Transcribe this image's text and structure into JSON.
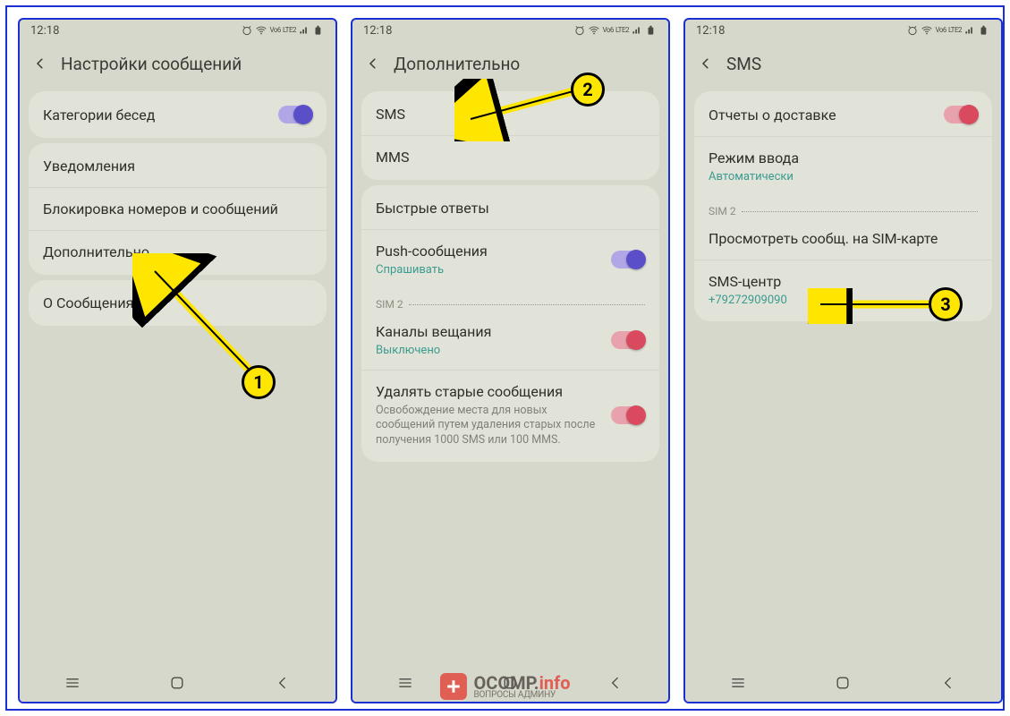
{
  "status": {
    "time": "12:18",
    "lte": "LTE2",
    "vo": "Vo6"
  },
  "phone1": {
    "header": "Настройки сообщений",
    "items": {
      "categories": "Категории бесед",
      "notifications": "Уведомления",
      "blocking": "Блокировка номеров и сообщений",
      "additional": "Дополнительно",
      "about": "О Сообщения"
    }
  },
  "phone2": {
    "header": "Дополнительно",
    "items": {
      "sms": "SMS",
      "mms": "MMS",
      "quick": "Быстрые ответы",
      "push": "Push-сообщения",
      "push_sub": "Спрашивать",
      "sim": "SIM 2",
      "channels": "Каналы вещания",
      "channels_sub": "Выключено",
      "delete_old": "Удалять старые сообщения",
      "delete_old_sub": "Освобождение места для новых сообщений путем удаления старых после получения 1000 SMS или 100 MMS."
    }
  },
  "phone3": {
    "header": "SMS",
    "items": {
      "delivery": "Отчеты о доставке",
      "input_mode": "Режим ввода",
      "input_mode_sub": "Автоматически",
      "sim": "SIM 2",
      "view_sim": "Просмотреть сообщ. на SIM-карте",
      "sms_center": "SMS-центр",
      "sms_center_sub": "+79272909090"
    }
  },
  "annotations": {
    "b1": "1",
    "b2": "2",
    "b3": "3"
  },
  "watermark": {
    "text": "OCOMP.",
    "suffix": "info",
    "sub": "ВОПРОСЫ АДМИНУ"
  }
}
